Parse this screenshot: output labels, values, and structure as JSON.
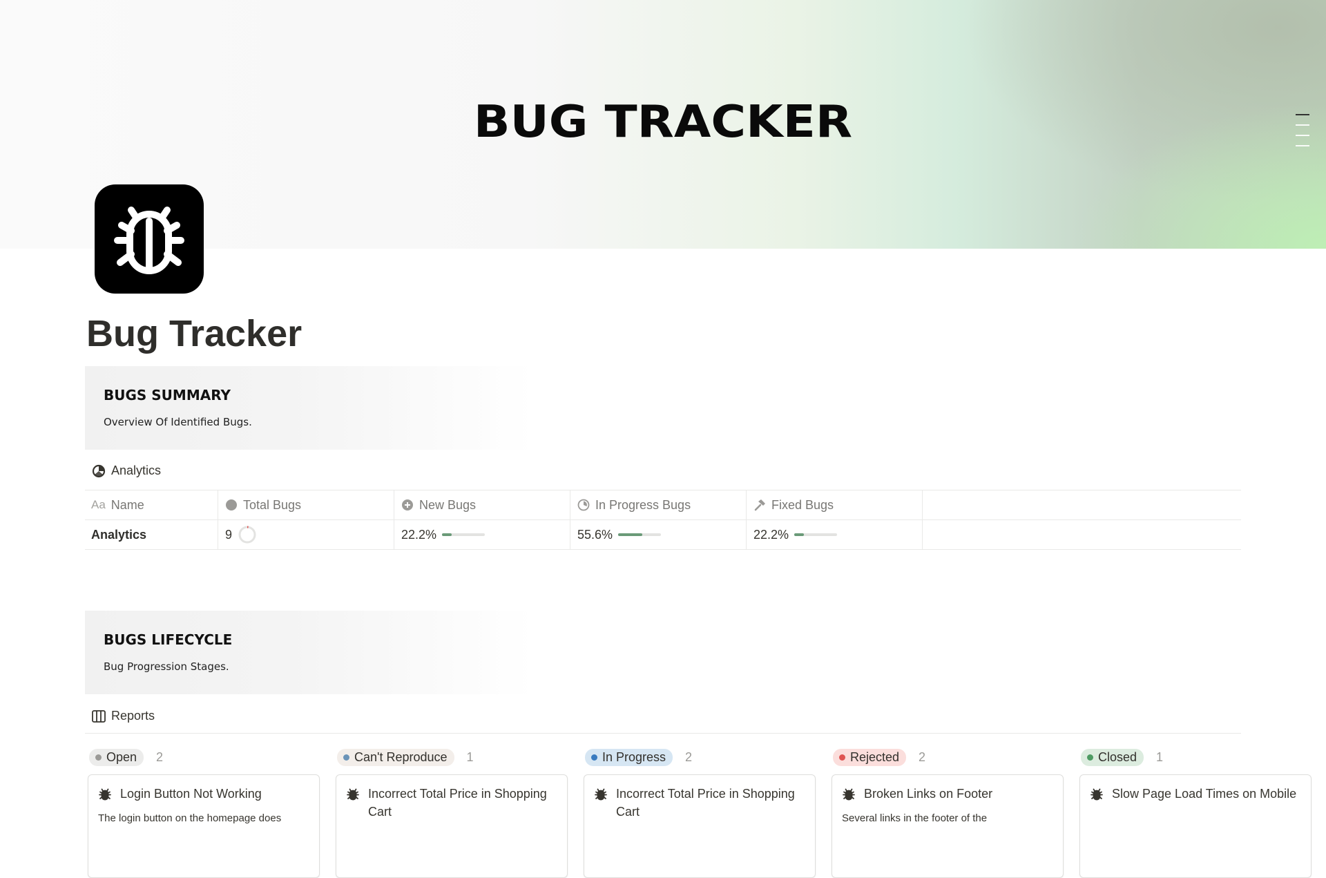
{
  "cover": {
    "title": "BUG TRACKER"
  },
  "page": {
    "title": "Bug Tracker"
  },
  "summary": {
    "title": "BUGS SUMMARY",
    "subtitle": "Overview Of Identified Bugs."
  },
  "analytics": {
    "view_label": "Analytics",
    "columns": [
      "Name",
      "Total Bugs",
      "New Bugs",
      "In Progress Bugs",
      "Fixed Bugs"
    ],
    "row": {
      "name": "Analytics",
      "total": "9",
      "new_pct": "22.2%",
      "new_value": 0.222,
      "inprog_pct": "55.6%",
      "inprog_value": 0.556,
      "fixed_pct": "22.2%",
      "fixed_value": 0.222
    }
  },
  "lifecycle": {
    "title": "BUGS LIFECYCLE",
    "subtitle": "Bug Progression Stages."
  },
  "reports": {
    "view_label": "Reports",
    "columns": [
      {
        "label": "Open",
        "count": "2",
        "tag_bg": "#ececeb",
        "dot": "#9b9a97",
        "card_title": "Login Button Not Working",
        "card_desc": "The login button on the homepage does"
      },
      {
        "label": "Can't Reproduce",
        "count": "1",
        "tag_bg": "#f3eeea",
        "dot": "#6b94b8",
        "card_title": "Incorrect Total Price in Shopping Cart",
        "card_desc": ""
      },
      {
        "label": "In Progress",
        "count": "2",
        "tag_bg": "#d6e6f3",
        "dot": "#3a7bbf",
        "card_title": "Incorrect Total Price in Shopping Cart",
        "card_desc": ""
      },
      {
        "label": "Rejected",
        "count": "2",
        "tag_bg": "#fbdedc",
        "dot": "#df5452",
        "card_title": "Broken Links on Footer",
        "card_desc": "Several links in the footer of the"
      },
      {
        "label": "Closed",
        "count": "1",
        "tag_bg": "#dcecdf",
        "dot": "#4e9b63",
        "card_title": "Slow Page Load Times on Mobile",
        "card_desc": ""
      }
    ]
  },
  "icons": {
    "page": "bug-icon",
    "analytics_view": "pie-chart-icon",
    "reports_view": "board-columns-icon",
    "name_prop": "text-aa-icon",
    "total_prop": "circle-icon",
    "new_prop": "plus-circle-icon",
    "inprog_prop": "progress-circle-icon",
    "fixed_prop": "hammer-icon",
    "card": "bug-icon"
  }
}
